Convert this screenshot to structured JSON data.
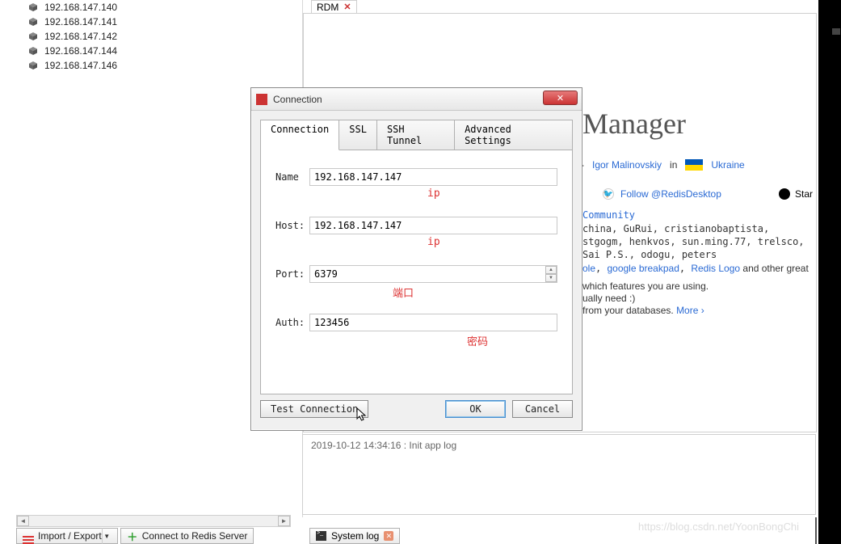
{
  "sidebar": {
    "items": [
      {
        "label": "192.168.147.140"
      },
      {
        "label": "192.168.147.141"
      },
      {
        "label": "192.168.147.142"
      },
      {
        "label": "192.168.147.144"
      },
      {
        "label": "192.168.147.146"
      }
    ]
  },
  "bottombar": {
    "import_export": "Import / Export",
    "connect": "Connect to Redis Server",
    "system_log": "System log"
  },
  "main": {
    "tab_label": "RDM",
    "title_fragment": " Manager",
    "subline_prefix": "- ",
    "author": "Igor Malinovskiy",
    "in": " in",
    "country": "Ukraine",
    "follow": "Follow @RedisDesktop",
    "star": "Star",
    "community_title": "Community",
    "community_body": "china, GuRui, cristianobaptista, stgogm, henkvos, sun.ming.77, trelsco, Sai P.S., odogu, peters",
    "libs_a": "ole",
    "libs_b": "google breakpad",
    "libs_c": "Redis Logo",
    "libs_tail": " and other great",
    "features_1": "which features you are using.",
    "features_2": "ually need :)",
    "features_3": "from your databases. ",
    "more": "More ›"
  },
  "log": {
    "line1": "2019-10-12 14:34:16 : Init app log"
  },
  "dialog": {
    "title": "Connection",
    "tabs": {
      "connection": "Connection",
      "ssl": "SSL",
      "ssh": "SSH Tunnel",
      "advanced": "Advanced Settings"
    },
    "labels": {
      "name": "Name",
      "host": "Host:",
      "port": "Port:",
      "auth": "Auth:"
    },
    "values": {
      "name": "192.168.147.147",
      "host": "192.168.147.147",
      "port": "6379",
      "auth": "123456"
    },
    "annotations": {
      "name": "ip",
      "host": "ip",
      "port": "端口",
      "auth": "密码"
    },
    "buttons": {
      "test": "Test Connection",
      "ok": "OK",
      "cancel": "Cancel"
    }
  },
  "watermark": "https://blog.csdn.net/YoonBongChi"
}
